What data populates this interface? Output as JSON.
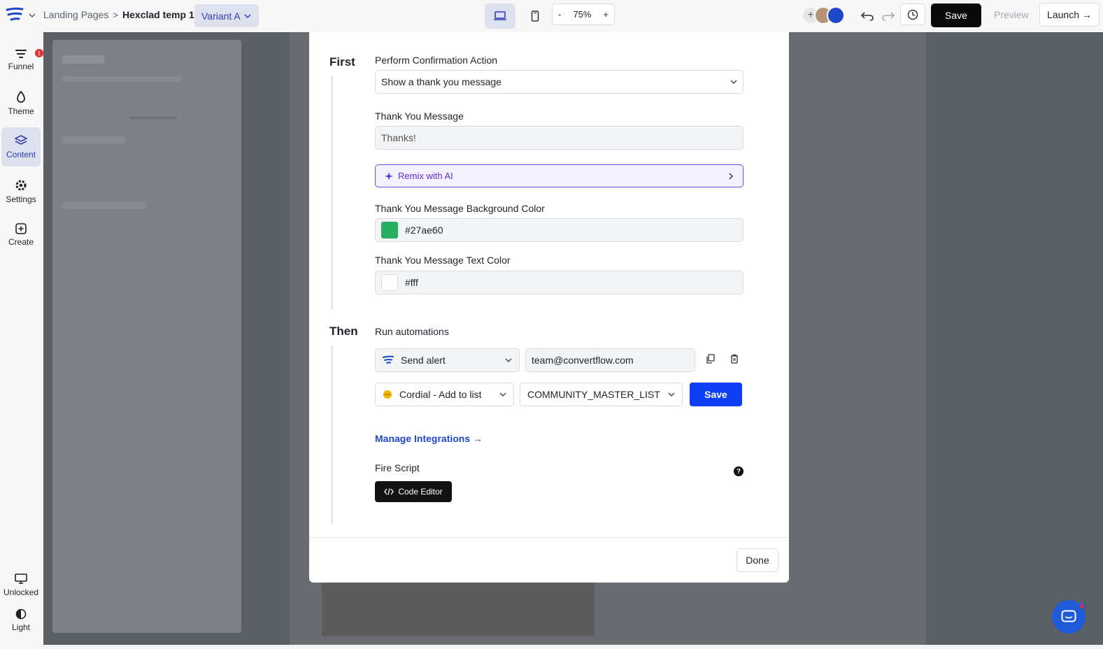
{
  "header": {
    "breadcrumb_root": "Landing Pages",
    "breadcrumb_sep": ">",
    "page_name": "Hexclad temp 1",
    "variant": "Variant A",
    "zoom_minus": "-",
    "zoom_value": "75%",
    "zoom_plus": "+",
    "save_label": "Save",
    "preview_label": "Preview",
    "launch_label": "Launch →"
  },
  "rail": {
    "items": [
      {
        "label": "Funnel",
        "icon": "funnel-icon",
        "badge": "1"
      },
      {
        "label": "Theme",
        "icon": "droplet-icon"
      },
      {
        "label": "Content",
        "icon": "layers-icon",
        "active": true
      },
      {
        "label": "Settings",
        "icon": "gear-icon"
      },
      {
        "label": "Create",
        "icon": "plus-square-icon"
      }
    ],
    "bottom": [
      {
        "label": "Unlocked",
        "icon": "monitor-icon"
      },
      {
        "label": "Light",
        "icon": "half-circle-icon"
      }
    ]
  },
  "modal": {
    "first_label": "First",
    "confirmation_label": "Perform Confirmation Action",
    "confirmation_value": "Show a thank you message",
    "thanks_label": "Thank You Message",
    "thanks_value": "Thanks!",
    "remix_label": "Remix with AI",
    "bg_color_label": "Thank You Message Background Color",
    "bg_color_value": "#27ae60",
    "text_color_label": "Thank You Message Text Color",
    "text_color_value": "#fff",
    "then_label": "Then",
    "automations_label": "Run automations",
    "automation1_action": "Send alert",
    "automation1_email": "team@convertflow.com",
    "automation2_action": "Cordial - Add to list",
    "automation2_list": "COMMUNITY_MASTER_LIST",
    "automation2_save": "Save",
    "manage_integrations": "Manage Integrations →",
    "fire_script_label": "Fire Script",
    "code_editor_label": "Code Editor",
    "help_glyph": "?",
    "done_label": "Done"
  },
  "colors": {
    "accent": "#2d3bb7",
    "primary_button": "#0b3ef5",
    "swatch_bg": "#27ae60",
    "swatch_text": "#ffffff",
    "remix_purple": "#7048e8"
  }
}
